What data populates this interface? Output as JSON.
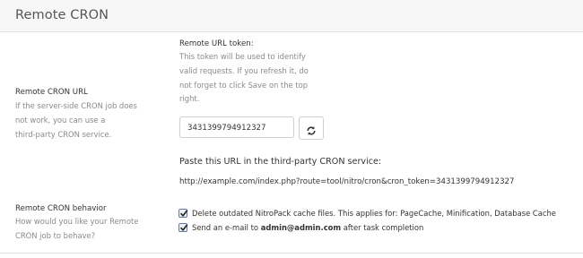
{
  "header": {
    "title": "Remote CRON"
  },
  "url_section": {
    "label": "Remote CRON URL",
    "description_lines": [
      "If the server-side CRON job does",
      "not work, you can use a",
      "third-party CRON service."
    ],
    "token_label": "Remote URL token:",
    "token_help_lines": [
      "This token will be used to identify",
      "valid requests. If you refresh it, do",
      "not forget to click Save on the top",
      "right."
    ],
    "token_value": "3431399794912327",
    "refresh_icon": "refresh-icon",
    "paste_label": "Paste this URL in the third-party CRON service:",
    "cron_url": "http://example.com/index.php?route=tool/nitro/cron&cron_token=3431399794912327"
  },
  "behavior_section": {
    "label": "Remote CRON behavior",
    "description_lines": [
      "How would you like your Remote",
      "CRON job to behave?"
    ],
    "options": [
      {
        "checked": true,
        "label": "Delete outdated NitroPack cache files. This applies for: PageCache, Minification, Database Cache"
      },
      {
        "checked": true,
        "label_prefix": "Send an e-mail to ",
        "email": "admin@admin.com",
        "label_suffix": " after task completion"
      }
    ]
  }
}
